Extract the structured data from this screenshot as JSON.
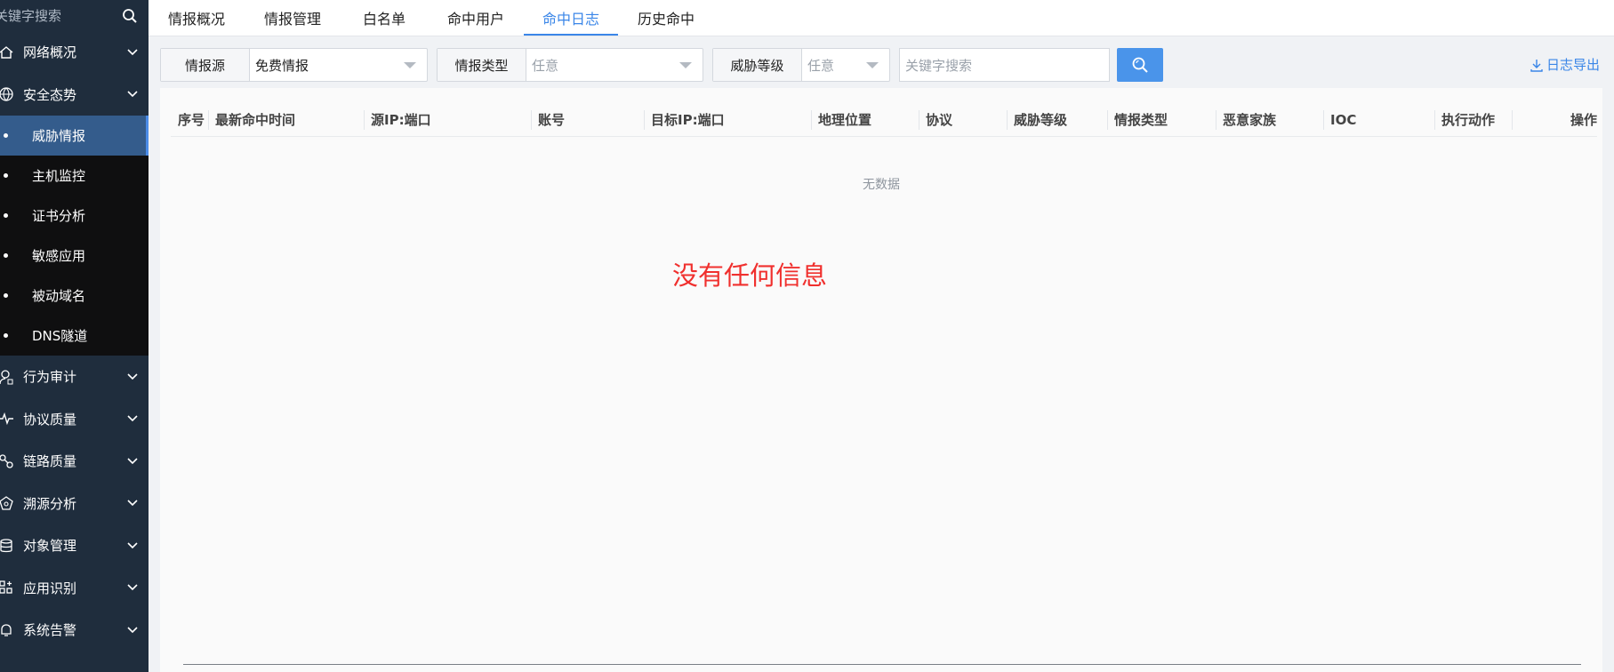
{
  "sidebar": {
    "search_placeholder": "关键字搜索",
    "menu_top": [
      {
        "label": "网络概况",
        "icon": "home-icon"
      },
      {
        "label": "安全态势",
        "icon": "globe-icon"
      }
    ],
    "submenu": [
      {
        "label": "威胁情报",
        "active": true
      },
      {
        "label": "主机监控"
      },
      {
        "label": "证书分析"
      },
      {
        "label": "敏感应用"
      },
      {
        "label": "被动域名"
      },
      {
        "label": "DNS隧道"
      }
    ],
    "menu_bottom": [
      {
        "label": "行为审计",
        "icon": "user-audit-icon"
      },
      {
        "label": "协议质量",
        "icon": "pulse-icon"
      },
      {
        "label": "链路质量",
        "icon": "link-icon"
      },
      {
        "label": "溯源分析",
        "icon": "trace-icon"
      },
      {
        "label": "对象管理",
        "icon": "database-icon"
      },
      {
        "label": "应用识别",
        "icon": "apps-icon"
      },
      {
        "label": "系统告警",
        "icon": "bell-icon"
      }
    ]
  },
  "tabs": [
    "情报概况",
    "情报管理",
    "白名单",
    "命中用户",
    "命中日志",
    "历史命中"
  ],
  "active_tab": "命中日志",
  "filters": {
    "source": {
      "label": "情报源",
      "value": "免费情报"
    },
    "type": {
      "label": "情报类型",
      "value": "任意"
    },
    "level": {
      "label": "威胁等级",
      "value": "任意"
    },
    "keyword_placeholder": "关键字搜索"
  },
  "export_label": "日志导出",
  "table": {
    "columns": [
      "序号",
      "最新命中时间",
      "源IP:端口",
      "账号",
      "目标IP:端口",
      "地理位置",
      "协议",
      "威胁等级",
      "情报类型",
      "恶意家族",
      "IOC",
      "执行动作",
      "操作"
    ],
    "empty_text": "无数据"
  },
  "overlay_message": "没有任何信息",
  "colors": {
    "accent": "#3a86e8",
    "sidebar_bg": "#1f2d3d",
    "active_sub_bg": "#345c8c",
    "alert_red": "#f0302e"
  }
}
